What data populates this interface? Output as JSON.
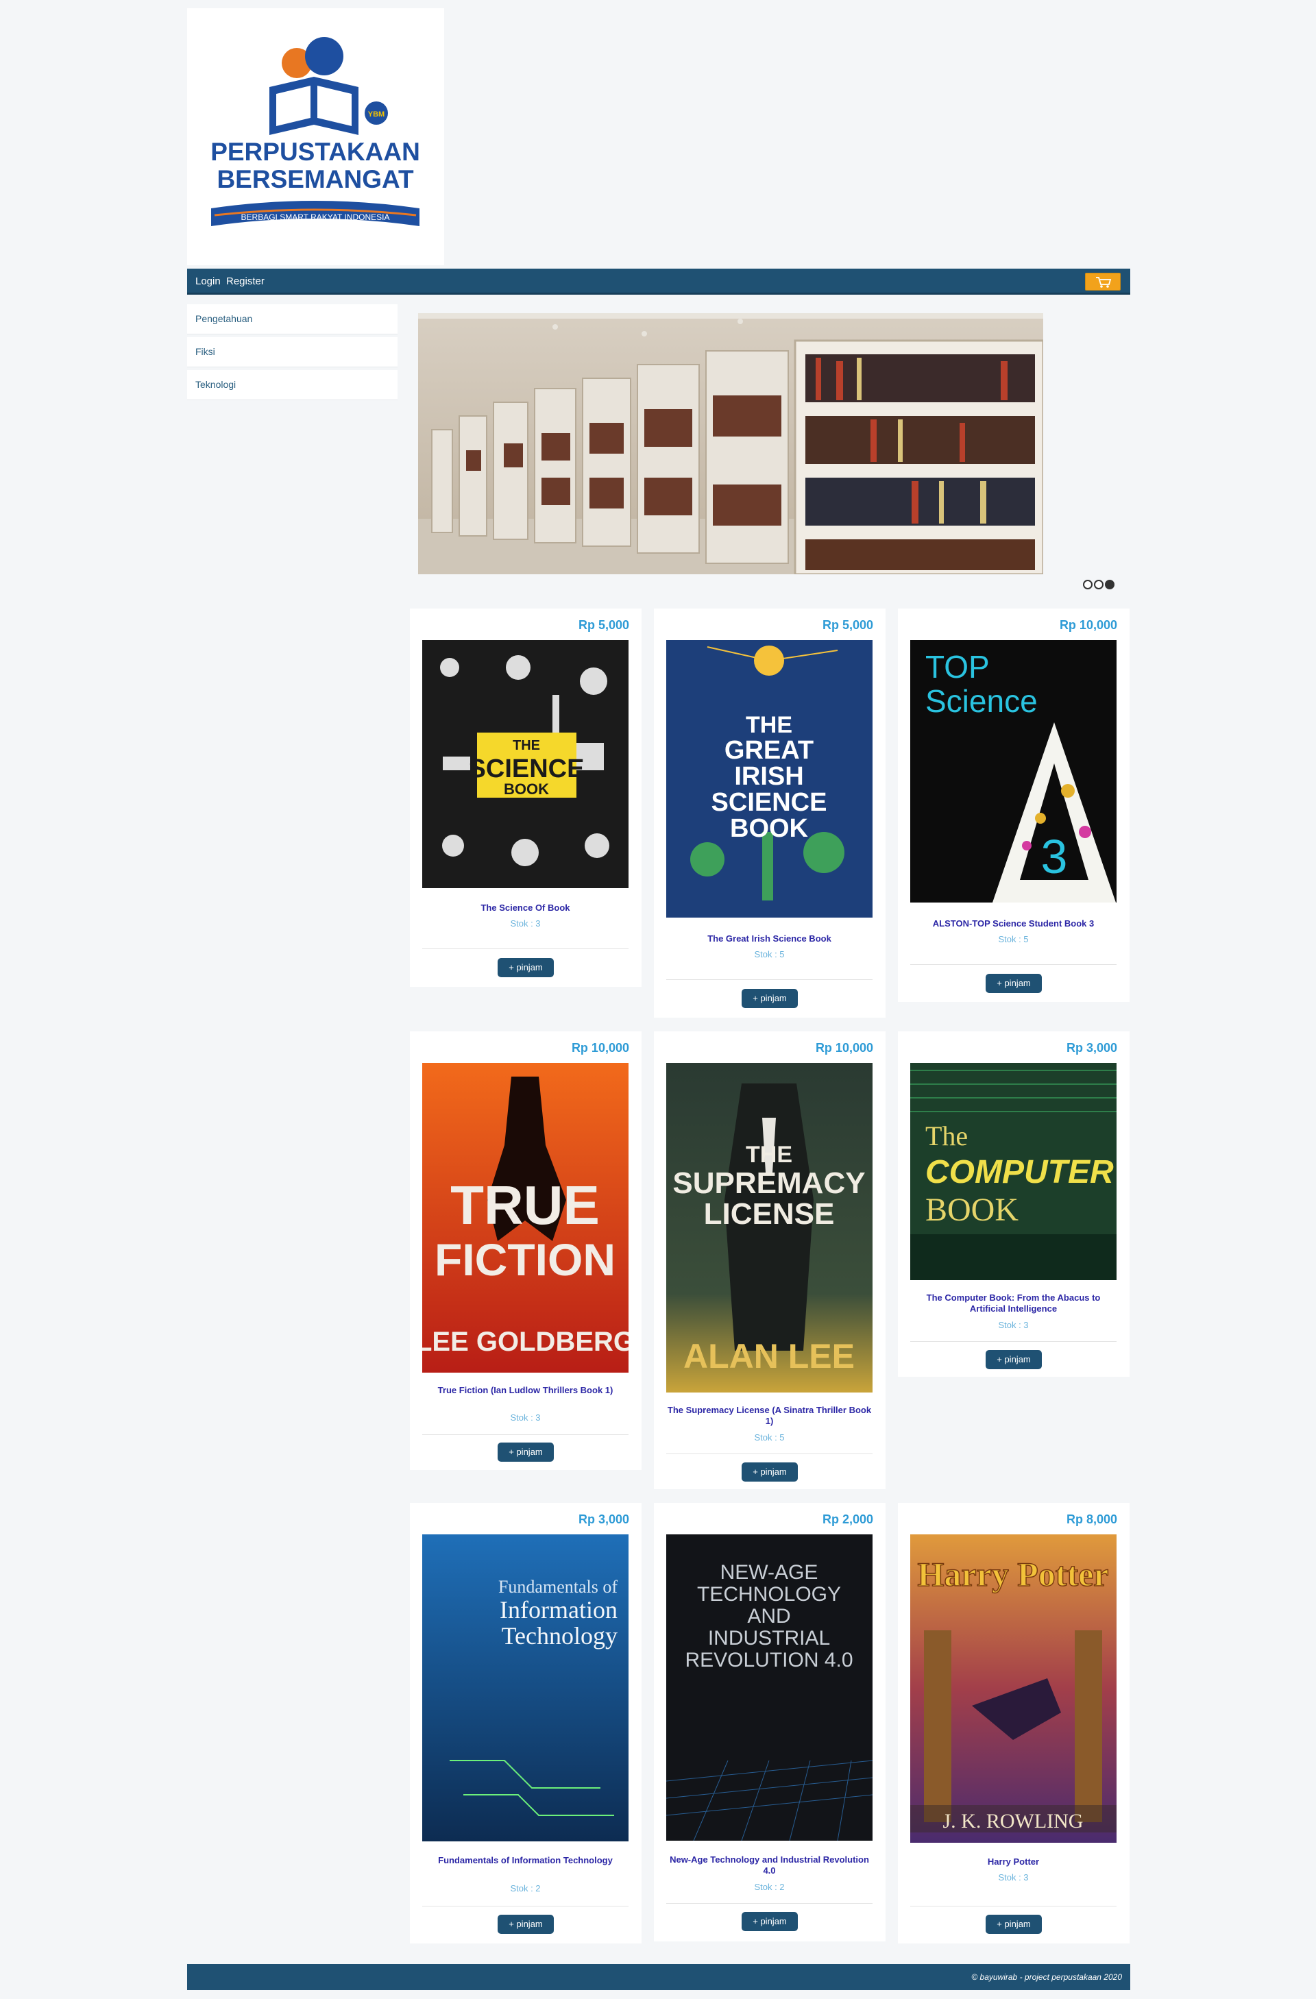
{
  "logo": {
    "title_line1": "PERPUSTAKAAN",
    "title_line2": "BERSEMANGAT",
    "tagline": "BERBAGI SMART RAKYAT INDONESIA",
    "badge": "YBM"
  },
  "nav": {
    "login": "Login",
    "register": "Register",
    "cart_icon": "cart-icon"
  },
  "sidebar": {
    "items": [
      {
        "label": "Pengetahuan"
      },
      {
        "label": "Fiksi"
      },
      {
        "label": "Teknologi"
      }
    ]
  },
  "carousel": {
    "slide_count": 3,
    "active_index": 2
  },
  "products": [
    {
      "price": "Rp 5,000",
      "title": "The Science Of Book",
      "stock": "Stok : 3",
      "button": "+ pinjam",
      "cover_text": [
        "THE",
        "SCIENCE",
        "BOOK"
      ],
      "cover_color": "#1b1b1b"
    },
    {
      "price": "Rp 5,000",
      "title": "The Great Irish Science Book",
      "stock": "Stok : 5",
      "button": "+ pinjam",
      "cover_text": [
        "THE",
        "GREAT",
        "IRISH",
        "SCIENCE",
        "BOOK"
      ],
      "cover_color": "#1d3f7a"
    },
    {
      "price": "Rp 10,000",
      "title": "ALSTON-TOP Science Student Book 3",
      "stock": "Stok : 5",
      "button": "+ pinjam",
      "cover_text": [
        "TOP",
        "Science",
        "3"
      ],
      "cover_color": "#0c0c0c"
    },
    {
      "price": "Rp 10,000",
      "title": "True Fiction (Ian Ludlow Thrillers Book 1)",
      "stock": "Stok : 3",
      "button": "+ pinjam",
      "cover_text": [
        "TRUE",
        "FICTION",
        "LEE GOLDBERG"
      ],
      "cover_color": "#d8361c"
    },
    {
      "price": "Rp 10,000",
      "title": "The Supremacy License (A Sinatra Thriller Book 1)",
      "stock": "Stok : 5",
      "button": "+ pinjam",
      "cover_text": [
        "THE",
        "SUPREMACY",
        "LICENSE",
        "ALAN LEE"
      ],
      "cover_color": "#3a4a3f"
    },
    {
      "price": "Rp 3,000",
      "title": "The Computer Book: From the Abacus to Artificial Intelligence",
      "stock": "Stok : 3",
      "button": "+ pinjam",
      "cover_text": [
        "The",
        "COMPUTER",
        "BOOK"
      ],
      "cover_color": "#1c3f2a"
    },
    {
      "price": "Rp 3,000",
      "title": "Fundamentals of Information Technology",
      "stock": "Stok : 2",
      "button": "+ pinjam",
      "cover_text": [
        "Fundamentals of",
        "Information",
        "Technology"
      ],
      "cover_color": "#1f6fb8"
    },
    {
      "price": "Rp 2,000",
      "title": "New-Age Technology and Industrial Revolution 4.0",
      "stock": "Stok : 2",
      "button": "+ pinjam",
      "cover_text": [
        "NEW-AGE",
        "TECHNOLOGY",
        "AND",
        "INDUSTRIAL",
        "REVOLUTION 4.0"
      ],
      "cover_color": "#121418"
    },
    {
      "price": "Rp 8,000",
      "title": "Harry Potter",
      "stock": "Stok : 3",
      "button": "+ pinjam",
      "cover_text": [
        "Harry Potter",
        "J. K. ROWLING"
      ],
      "cover_color": "#6a3c8c"
    }
  ],
  "footer": {
    "text": "© bayuwirab - project perpustakaan 2020"
  }
}
